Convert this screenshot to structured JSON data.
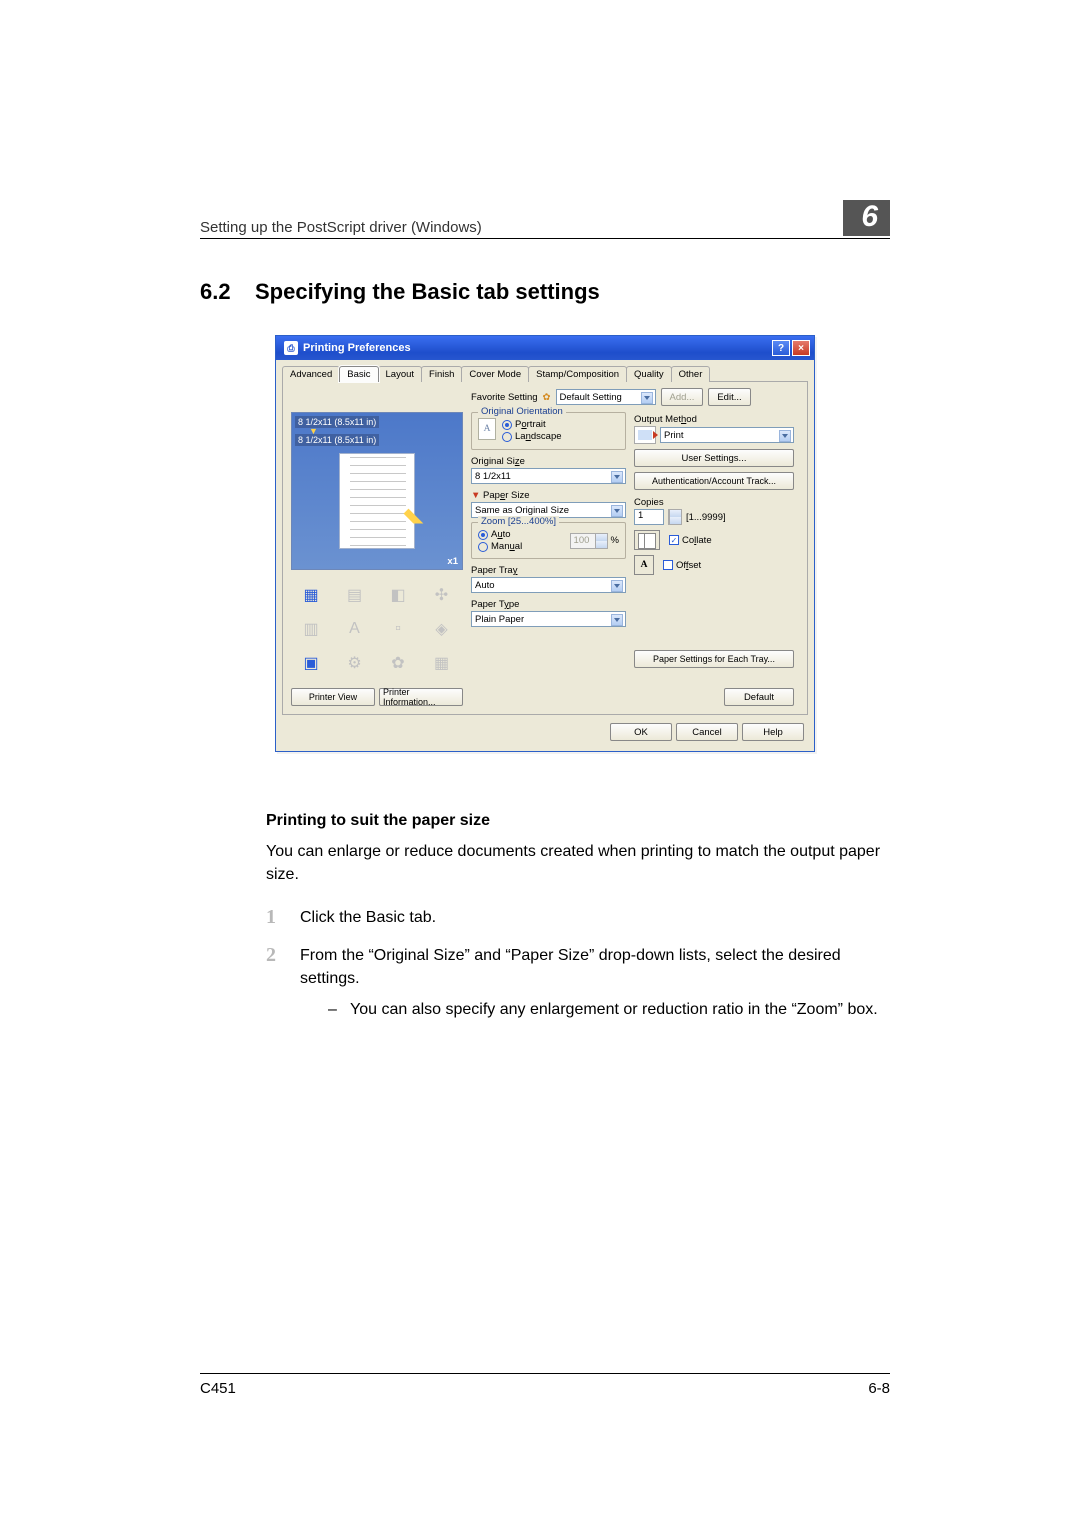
{
  "header": {
    "running": "Setting up the PostScript driver (Windows)",
    "chapter": "6"
  },
  "section": {
    "num": "6.2",
    "title": "Specifying the Basic tab settings"
  },
  "dialog": {
    "title": "Printing Preferences",
    "tabs": [
      "Advanced",
      "Basic",
      "Layout",
      "Finish",
      "Cover Mode",
      "Stamp/Composition",
      "Quality",
      "Other"
    ],
    "activeTab": "Basic",
    "favorite": {
      "label": "Favorite Setting",
      "value": "Default Setting",
      "add": "Add...",
      "edit": "Edit..."
    },
    "preview": {
      "line1": "8 1/2x11 (8.5x11 in)",
      "line2": "8 1/2x11 (8.5x11 in)",
      "scale": "x1",
      "printerView": "Printer View",
      "printerInfo": "Printer Information..."
    },
    "orient": {
      "group": "Original Orientation",
      "portrait": "Portrait",
      "landscape": "Landscape",
      "selected": "Portrait"
    },
    "origSize": {
      "label": "Original Size",
      "value": "8 1/2x11"
    },
    "paperSize": {
      "label": "Paper Size",
      "value": "Same as Original Size"
    },
    "zoom": {
      "group": "Zoom [25...400%]",
      "auto": "Auto",
      "manual": "Manual",
      "value": "100",
      "pct": "%",
      "selected": "Auto"
    },
    "paperTray": {
      "label": "Paper Tray",
      "value": "Auto"
    },
    "paperType": {
      "label": "Paper Type",
      "value": "Plain Paper"
    },
    "output": {
      "group": "Output Method",
      "value": "Print",
      "userSettings": "User Settings...",
      "auth": "Authentication/Account Track..."
    },
    "copies": {
      "label": "Copies",
      "value": "1",
      "range": "[1...9999]",
      "collate": "Collate",
      "offset": "Offset"
    },
    "perTray": "Paper Settings for Each Tray...",
    "default": "Default",
    "ok": "OK",
    "cancel": "Cancel",
    "help": "Help"
  },
  "content": {
    "subhead": "Printing to suit the paper size",
    "intro": "You can enlarge or reduce documents created when printing to match the output paper size.",
    "step1": "Click the Basic tab.",
    "step2": "From the “Original Size” and “Paper Size” drop-down lists, select the desired settings.",
    "step2sub": "You can also specify any enlargement or reduction ratio in the “Zoom” box."
  },
  "footer": {
    "left": "C451",
    "right": "6-8"
  }
}
